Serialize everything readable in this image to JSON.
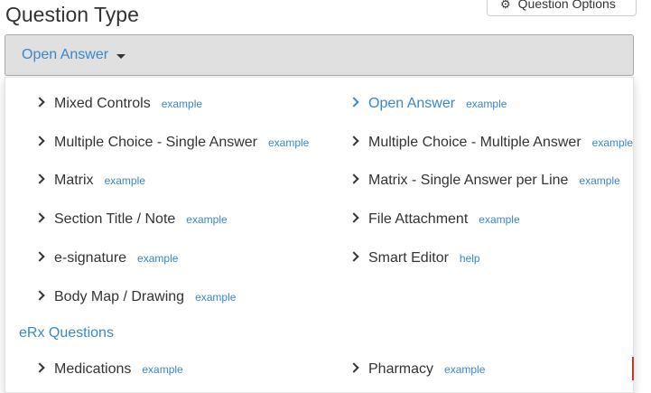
{
  "page": {
    "title": "Question Type",
    "options_button": {
      "label": "Question Options",
      "icon": "gear-icon"
    }
  },
  "select": {
    "value": "Open Answer",
    "icon": "caret-down-icon"
  },
  "menu": {
    "items": [
      {
        "label": "Mixed Controls",
        "link": "example",
        "active": false
      },
      {
        "label": "Open Answer",
        "link": "example",
        "active": true
      },
      {
        "label": "Multiple Choice - Single Answer",
        "link": "example",
        "active": false
      },
      {
        "label": "Multiple Choice - Multiple Answer",
        "link": "example",
        "active": false
      },
      {
        "label": "Matrix",
        "link": "example",
        "active": false
      },
      {
        "label": "Matrix - Single Answer per Line",
        "link": "example",
        "active": false
      },
      {
        "label": "Section Title / Note",
        "link": "example",
        "active": false
      },
      {
        "label": "File Attachment",
        "link": "example",
        "active": false
      },
      {
        "label": "e-signature",
        "link": "example",
        "active": false
      },
      {
        "label": "Smart Editor",
        "link": "help",
        "active": false
      },
      {
        "label": "Body Map / Drawing",
        "link": "example",
        "active": false
      }
    ],
    "section_header": "eRx Questions",
    "erx_items": [
      {
        "label": "Medications",
        "link": "example"
      },
      {
        "label": "Pharmacy",
        "link": "example"
      }
    ]
  },
  "colors": {
    "accent": "#3a87c8",
    "text": "#333333",
    "select_bg": "#e0e0e0"
  }
}
